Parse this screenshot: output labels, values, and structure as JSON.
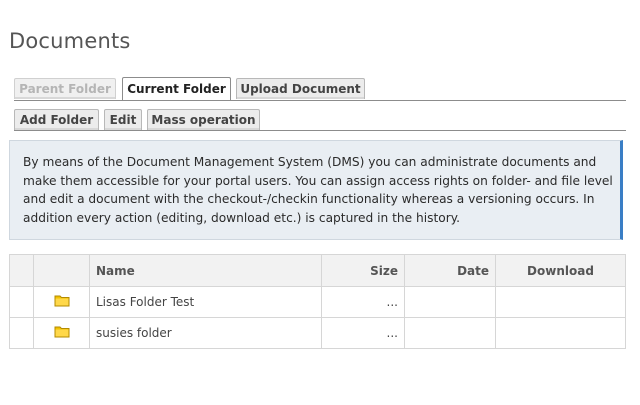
{
  "page": {
    "title": "Documents"
  },
  "tabs": [
    {
      "label": "Parent Folder",
      "state": "disabled"
    },
    {
      "label": "Current Folder",
      "state": "active"
    },
    {
      "label": "Upload Document",
      "state": "normal"
    }
  ],
  "actions": [
    {
      "label": "Add Folder"
    },
    {
      "label": "Edit"
    },
    {
      "label": "Mass operation"
    }
  ],
  "info": {
    "text": "By means of the Document Management System (DMS) you can administrate documents and make them accessible for your portal users. You can assign access rights on folder- and file level and edit a document with the checkout-/checkin functionality whereas a versioning occurs. In addition every action (editing, download etc.) is captured in the history."
  },
  "table": {
    "columns": [
      "",
      "",
      "Name",
      "Size",
      "Date",
      "Download"
    ],
    "rows": [
      {
        "icon": "folder-icon",
        "name": "Lisas Folder Test",
        "size": "...",
        "date": "",
        "download": ""
      },
      {
        "icon": "folder-icon",
        "name": "susies folder",
        "size": "...",
        "date": "",
        "download": ""
      }
    ]
  },
  "colors": {
    "accent": "#3a7ec5",
    "info_bg": "#e9eef3",
    "folder": "#f2c200"
  }
}
